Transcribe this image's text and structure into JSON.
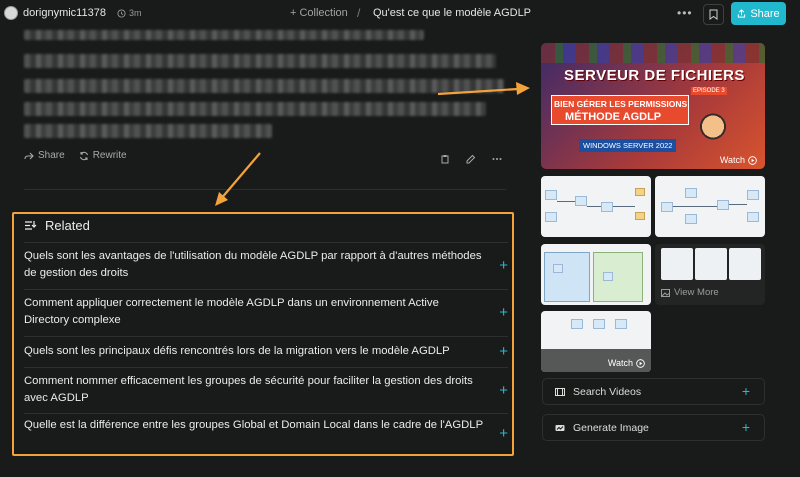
{
  "header": {
    "username": "dorignymic11378",
    "time": "3m",
    "collection_label": "+ Collection",
    "separator": "/",
    "title": "Qu'est ce que le modèle AGDLP",
    "share_label": "Share"
  },
  "actions": {
    "share_label": "Share",
    "rewrite_label": "Rewrite"
  },
  "related": {
    "heading": "Related",
    "items": [
      {
        "text": "Quels sont les avantages de l'utilisation du modèle AGDLP par rapport à d'autres méthodes de gestion des droits"
      },
      {
        "text": "Comment appliquer correctement le modèle AGDLP dans un environnement Active Directory complexe"
      },
      {
        "text": "Quels sont les principaux défis rencontrés lors de la migration vers le modèle AGDLP"
      },
      {
        "text": "Comment nommer efficacement les groupes de sécurité pour faciliter la gestion des droits avec AGDLP"
      },
      {
        "text": "Quelle est la différence entre les groupes Global et Domain Local dans le cadre de l'AGDLP"
      }
    ]
  },
  "video": {
    "title": "SERVEUR DE FICHIERS",
    "line1": "BIEN GÉRER LES PERMISSIONS",
    "line2": "MÉTHODE AGDLP",
    "episode": "EPISODE 3",
    "os": "WINDOWS SERVER 2022",
    "watch_label": "Watch"
  },
  "media": {
    "view_more_label": "View More",
    "watch_label_2": "Watch"
  },
  "tools": {
    "search_videos": "Search Videos",
    "generate_image": "Generate Image"
  },
  "colors": {
    "accent": "#21b8cd",
    "highlight": "#f4a23a",
    "background": "#191a1a"
  }
}
